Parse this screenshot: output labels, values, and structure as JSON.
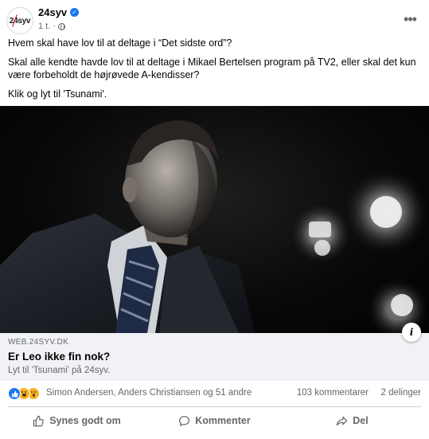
{
  "page": {
    "name": "24syv",
    "avatar_text": "24syv",
    "time": "1 t.",
    "separator": "·"
  },
  "post": {
    "paragraphs": [
      "Hvem skal have lov til at deltage i “Det sidste ord”?",
      "Skal alle kendte havde lov til at deltage i Mikael Bertelsen program på TV2, eller skal det kun være forbeholdt de højrøvede A-kendisser?",
      "Klik og lyt til 'Tsunami'."
    ]
  },
  "link": {
    "domain": "WEB.24SYV.DK",
    "title": "Er Leo ikke fin nok?",
    "description": "Lyt til 'Tsunami' på 24syv."
  },
  "reactions": {
    "icons": [
      "like-icon",
      "haha-icon",
      "wow-icon"
    ],
    "reactors": "Simon Andersen, Anders Christiansen og 51 andre",
    "comments": "103 kommentarer",
    "shares": "2 delinger"
  },
  "actions": {
    "like": "Synes godt om",
    "comment": "Kommenter",
    "share": "Del"
  },
  "colors": {
    "accent": "#1877f2",
    "secondary_text": "#65676b",
    "link_bg": "#f0f2f5"
  }
}
